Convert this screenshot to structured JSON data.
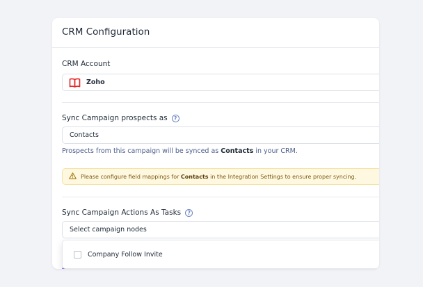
{
  "card": {
    "title": "CRM Configuration"
  },
  "crm_account": {
    "label": "CRM Account",
    "value": "Zoho",
    "icon": "zoho-book-icon",
    "icon_color": "#e42527"
  },
  "sync_prospects": {
    "label": "Sync Campaign prospects as",
    "value": "Contacts",
    "info_prefix": "Prospects from this campaign will be synced as ",
    "info_bold": "Contacts",
    "info_suffix": " in your CRM."
  },
  "warning": {
    "prefix": "Please configure field mappings for ",
    "bold": "Contacts",
    "suffix": " in the Integration Settings to ensure proper syncing.",
    "icon": "warning-triangle-icon"
  },
  "sync_actions": {
    "label": "Sync Campaign Actions As Tasks",
    "placeholder": "Select campaign nodes",
    "options": [
      {
        "label": "Company Follow Invite",
        "checked": false
      }
    ]
  },
  "colors": {
    "accent": "#4b5d8c",
    "warning_bg": "#fff8e1",
    "button_gradient_start": "#8b5cf6",
    "button_gradient_end": "#3b82f6"
  }
}
